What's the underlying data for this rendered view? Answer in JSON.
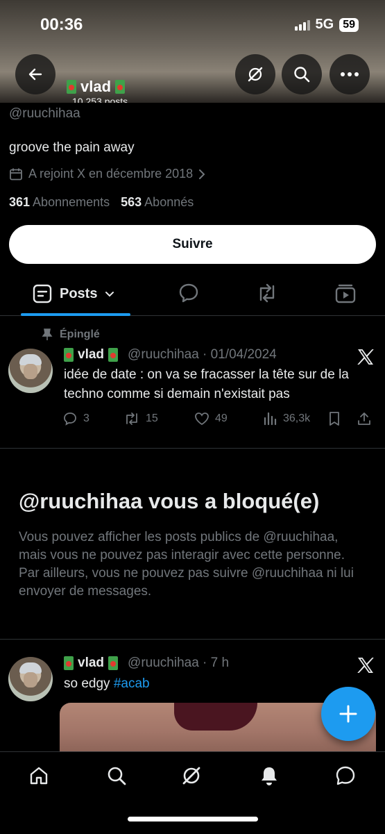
{
  "status_bar": {
    "time": "00:36",
    "network": "5G",
    "battery": "59"
  },
  "header": {
    "name": "vlad",
    "post_count": "10 253 posts"
  },
  "profile": {
    "handle": "@ruuchihaa",
    "bio": "groove the pain away",
    "joined": "A rejoint X en décembre 2018",
    "following_count": "361",
    "following_label": "Abonnements",
    "followers_count": "563",
    "followers_label": "Abonnés",
    "follow_button": "Suivre"
  },
  "tabs": {
    "active_label": "Posts"
  },
  "pinned_tweet": {
    "pinned_label": "Épinglé",
    "name": "vlad",
    "handle_date": "@ruuchihaa · 01/04/2024",
    "text": "idée de date : on va se fracasser la tête sur de la techno comme si demain n'existait pas",
    "replies": "3",
    "reposts": "15",
    "likes": "49",
    "views": "36,3k"
  },
  "blocked": {
    "title": "@ruuchihaa vous a bloqué(e)",
    "text": "Vous pouvez afficher les posts publics de @ruuchihaa, mais vous ne pouvez pas interagir avec cette personne. Par ailleurs, vous ne pouvez pas suivre @ruuchihaa ni lui envoyer de messages."
  },
  "second_tweet": {
    "name": "vlad",
    "handle_time": "@ruuchihaa · 7 h",
    "text_prefix": "so edgy ",
    "hashtag": "#acab"
  },
  "colors": {
    "accent": "#1d9bf0",
    "muted": "#71767b",
    "background": "#000000"
  },
  "icons": [
    "back-arrow-icon",
    "grok-icon",
    "search-icon",
    "more-icon",
    "calendar-icon",
    "chevron-right-icon",
    "posts-icon",
    "chevron-down-icon",
    "reply-icon",
    "repost-icon",
    "media-icon",
    "pin-icon",
    "x-logo-icon",
    "like-icon",
    "views-icon",
    "bookmark-icon",
    "share-icon",
    "plus-icon",
    "home-icon",
    "bell-icon",
    "messages-icon"
  ]
}
